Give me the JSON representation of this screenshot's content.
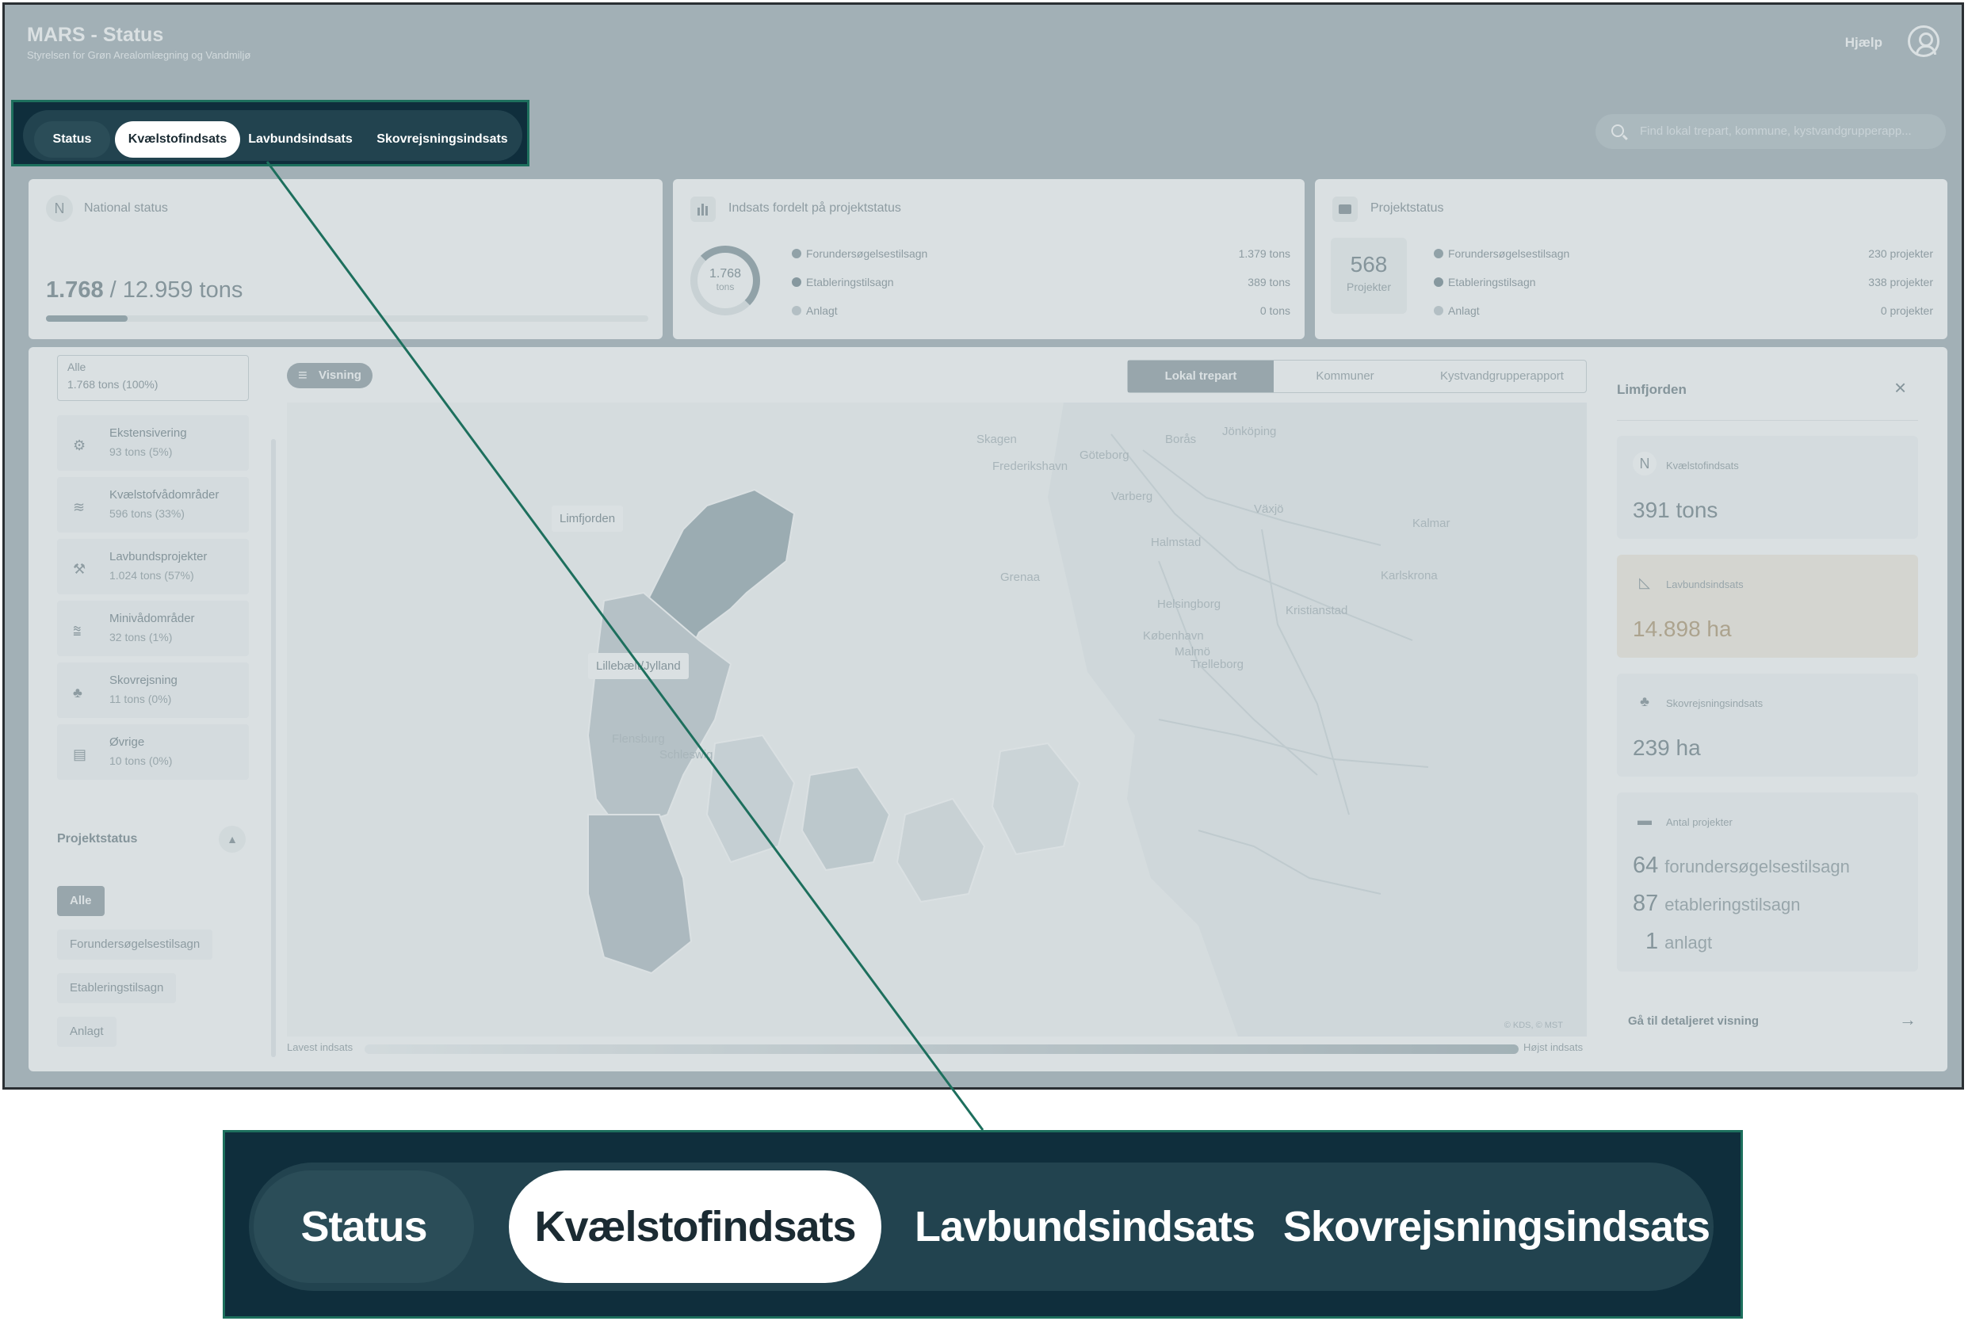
{
  "header": {
    "title": "MARS - Status",
    "subtitle": "Styrelsen for Grøn Arealomlægning og Vandmiljø",
    "help": "Hjælp"
  },
  "tabs": [
    {
      "label": "Status",
      "active": false
    },
    {
      "label": "Kvælstofindsats",
      "active": true
    },
    {
      "label": "Lavbundsindsats",
      "active": false
    },
    {
      "label": "Skovrejsningsindsats",
      "active": false
    }
  ],
  "search": {
    "placeholder": "Find lokal trepart, kommune, kystvandgrupperapp..."
  },
  "national_status": {
    "badge": "N",
    "title": "National status",
    "value": "1.768",
    "total": "/ 12.959 tons",
    "progress": 0.136
  },
  "indsats_status": {
    "title": "Indsats fordelt på projektstatus",
    "donut_value": "1.768",
    "donut_unit": "tons",
    "donut_fraction": 0.78,
    "rows": [
      {
        "label": "Forundersøgelsestilsagn",
        "value": "1.379 tons",
        "color": "#8fa0a7"
      },
      {
        "label": "Etableringstilsagn",
        "value": "389 tons",
        "color": "#7f9198"
      },
      {
        "label": "Anlagt",
        "value": "0 tons",
        "color": "#c4cdd1"
      }
    ]
  },
  "projekt_status": {
    "title": "Projektstatus",
    "count": "568",
    "count_label": "Projekter",
    "rows": [
      {
        "label": "Forundersøgelsestilsagn",
        "value": "230 projekter",
        "color": "#8fa0a7"
      },
      {
        "label": "Etableringstilsagn",
        "value": "338 projekter",
        "color": "#7f9198"
      },
      {
        "label": "Anlagt",
        "value": "0 projekter",
        "color": "#c4cdd1"
      }
    ]
  },
  "categories": {
    "alle": {
      "name": "Alle",
      "value": "1.768 tons (100%)"
    },
    "items": [
      {
        "name": "Ekstensivering",
        "value": "93 tons (5%)",
        "icon": "tractor-icon",
        "glyph": "⚙"
      },
      {
        "name": "Kvælstofvådområder",
        "value": "596 tons (33%)",
        "icon": "waves-icon",
        "glyph": "≋"
      },
      {
        "name": "Lavbundsprojekter",
        "value": "1.024 tons (57%)",
        "icon": "shovel-icon",
        "glyph": "⚒"
      },
      {
        "name": "Minivådområder",
        "value": "32 tons (1%)",
        "icon": "wetland-icon",
        "glyph": "⩰"
      },
      {
        "name": "Skovrejsning",
        "value": "11 tons (0%)",
        "icon": "trees-icon",
        "glyph": "♣"
      },
      {
        "name": "Øvrige",
        "value": "10 tons (0%)",
        "icon": "list-icon",
        "glyph": "▤"
      }
    ]
  },
  "projektstatus_filter": {
    "title": "Projektstatus",
    "chips": [
      {
        "label": "Alle",
        "active": true
      },
      {
        "label": "Forundersøgelsestilsagn",
        "active": false
      },
      {
        "label": "Etableringstilsagn",
        "active": false
      },
      {
        "label": "Anlagt",
        "active": false
      }
    ]
  },
  "map_controls": {
    "visning": "Visning",
    "segments": [
      "Lokal trepart",
      "Kommuner",
      "Kystvandgrupperapport"
    ],
    "active_segment": "Lokal trepart"
  },
  "map": {
    "labels": [
      "Skagen",
      "Frederikshavn",
      "Göteborg",
      "Borås",
      "Jönköping",
      "Varberg",
      "Växjö",
      "Halmstad",
      "Kalmar",
      "Karlskrona",
      "Helsingborg",
      "Kristianstad",
      "København",
      "Malmö",
      "Trelleborg",
      "Flensburg",
      "Schleswig",
      "Grenaa"
    ],
    "callouts": [
      "Limfjorden",
      "Lillebælt/Jylland"
    ],
    "attribution": "© KDS, © MST",
    "legend_low": "Lavest indsats",
    "legend_high": "Højst indsats"
  },
  "right_panel": {
    "title": "Limfjorden",
    "kvaelstof": {
      "title": "Kvælstofindsats",
      "value": "391 tons",
      "badge": "N"
    },
    "lavbund": {
      "title": "Lavbundsindsats",
      "value": "14.898 ha"
    },
    "skov": {
      "title": "Skovrejsningsindsats",
      "value": "239 ha"
    },
    "projekter": {
      "title": "Antal projekter",
      "rows": [
        {
          "num": "64",
          "label": "forundersøgelsestilsagn"
        },
        {
          "num": "87",
          "label": "etableringstilsagn"
        },
        {
          "num": "1",
          "label": "anlagt"
        }
      ]
    },
    "link": "Gå til detaljeret visning"
  },
  "colors": {
    "accent": "#1d6f5d",
    "nav_dark": "#0f2e3c",
    "nav_pill": "#22434f"
  }
}
